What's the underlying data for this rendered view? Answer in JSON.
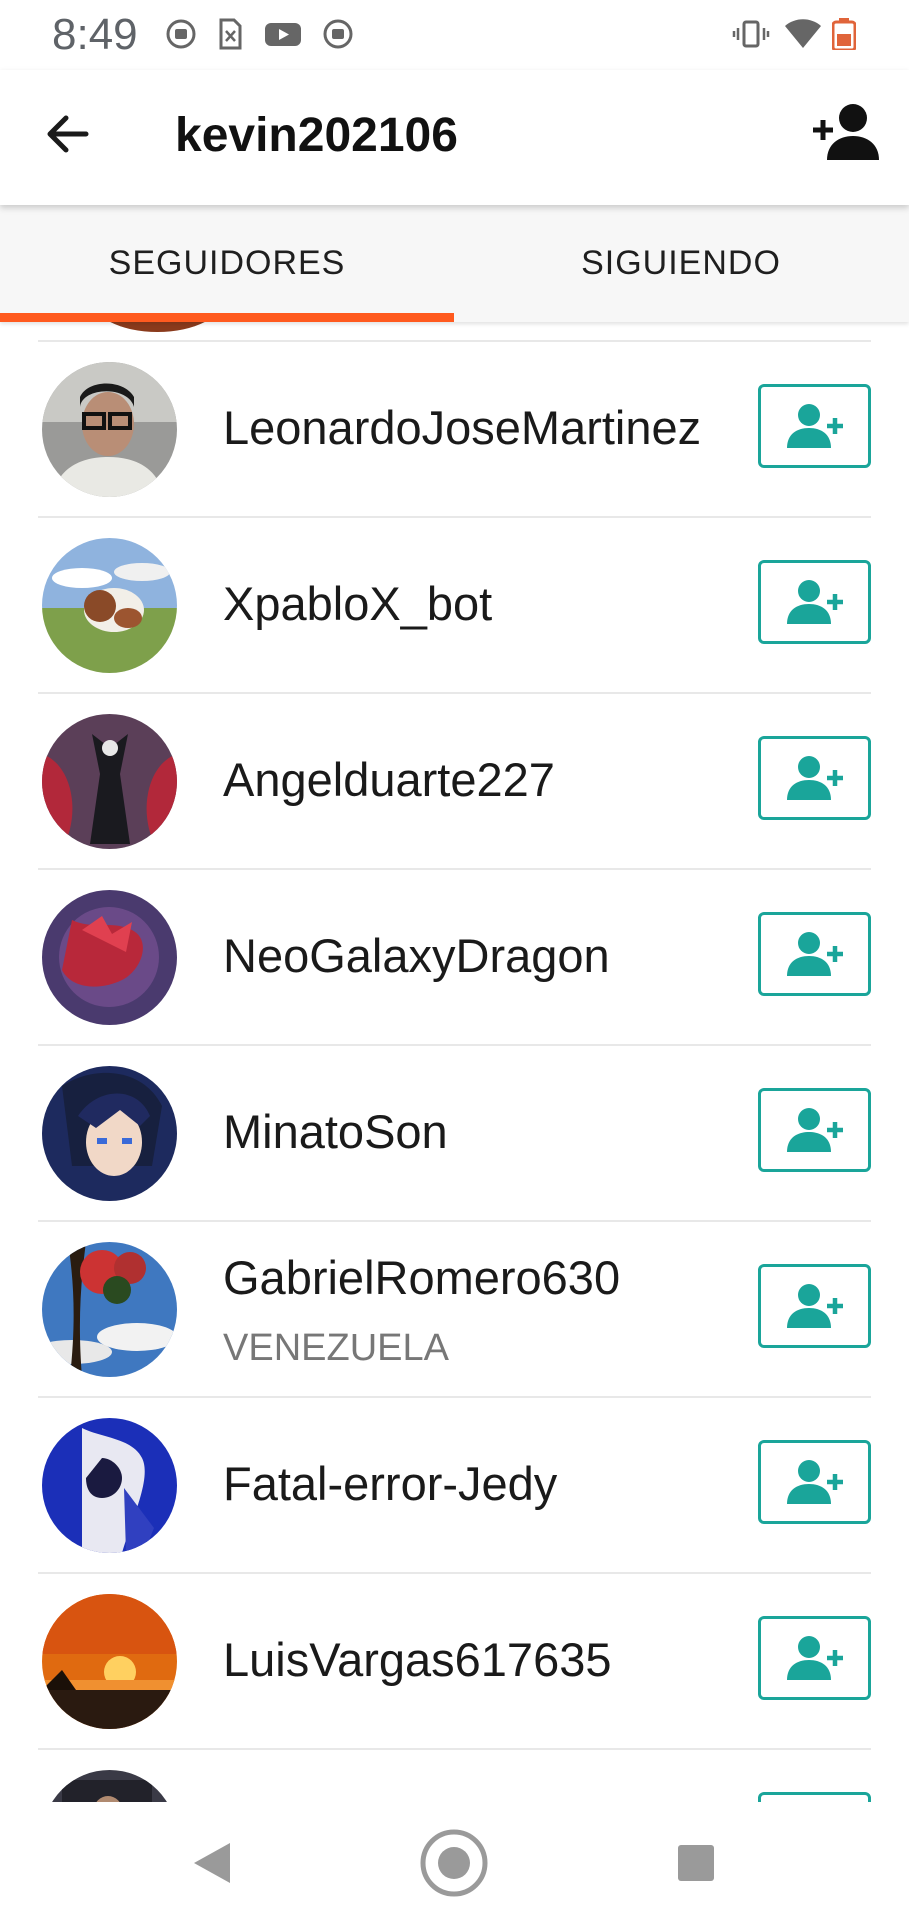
{
  "status_bar": {
    "time": "8:49",
    "icons": [
      "notification-icon",
      "sim-icon",
      "youtube-icon",
      "notification-icon",
      "vibrate-icon",
      "wifi-icon",
      "battery-icon"
    ]
  },
  "app_bar": {
    "title": "kevin202106",
    "back_icon": "arrow-back-icon",
    "action_icon": "add-person-icon"
  },
  "tabs": [
    {
      "label": "SEGUIDORES",
      "selected": true
    },
    {
      "label": "SIGUIENDO",
      "selected": false
    }
  ],
  "colors": {
    "accent": "#ff5a1f",
    "follow_button": "#1aa59a"
  },
  "followers": [
    {
      "name": "LeonardoJoseMartinez",
      "subtitle": ""
    },
    {
      "name": "XpabloX_bot",
      "subtitle": ""
    },
    {
      "name": "Angelduarte227",
      "subtitle": ""
    },
    {
      "name": "NeoGalaxyDragon",
      "subtitle": ""
    },
    {
      "name": "MinatoSon",
      "subtitle": ""
    },
    {
      "name": "GabrielRomero630",
      "subtitle": "VENEZUELA"
    },
    {
      "name": "Fatal-error-Jedy",
      "subtitle": ""
    },
    {
      "name": "LuisVargas617635",
      "subtitle": ""
    }
  ],
  "nav_bar": {
    "icons": [
      "back-triangle-icon",
      "home-circle-icon",
      "recents-square-icon"
    ]
  }
}
